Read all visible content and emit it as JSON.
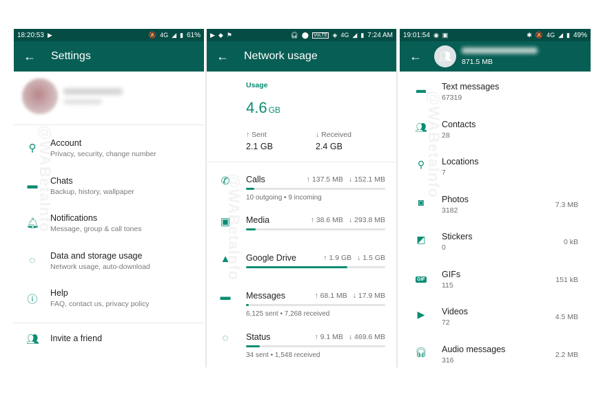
{
  "watermark": "@WABetaInfo",
  "colors": {
    "status_bar": "#054d44",
    "app_bar": "#075e54",
    "accent": "#0a8d73"
  },
  "settings_screen": {
    "status_time": "18:20:53",
    "status_network": "4G",
    "status_battery": "61%",
    "title": "Settings",
    "items": [
      {
        "icon": "key-icon",
        "title": "Account",
        "subtitle": "Privacy, security, change number"
      },
      {
        "icon": "chat-icon",
        "title": "Chats",
        "subtitle": "Backup, history, wallpaper"
      },
      {
        "icon": "bell-icon",
        "title": "Notifications",
        "subtitle": "Message, group & call tones"
      },
      {
        "icon": "data-usage-icon",
        "title": "Data and storage usage",
        "subtitle": "Network usage, auto-download"
      },
      {
        "icon": "help-icon",
        "title": "Help",
        "subtitle": "FAQ, contact us, privacy policy"
      }
    ],
    "invite": {
      "icon": "people-icon",
      "title": "Invite a friend"
    }
  },
  "network_screen": {
    "status_time": "7:24 AM",
    "status_volte": "VoLTE",
    "status_network": "4G",
    "title": "Network usage",
    "usage_label": "Usage",
    "usage_total": "4.6",
    "usage_unit": "GB",
    "sent_label": "Sent",
    "sent_value": "2.1 GB",
    "received_label": "Received",
    "received_value": "2.4 GB",
    "items": [
      {
        "icon": "phone-icon",
        "title": "Calls",
        "sent": "137.5 MB",
        "received": "152.1 MB",
        "progress": 0.06,
        "subtitle": "10 outgoing • 9 incoming"
      },
      {
        "icon": "photo-library-icon",
        "title": "Media",
        "sent": "38.6 MB",
        "received": "293.8 MB",
        "progress": 0.07,
        "subtitle": ""
      },
      {
        "icon": "google-drive-icon",
        "title": "Google Drive",
        "sent": "1.9 GB",
        "received": "1.5 GB",
        "progress": 0.73,
        "subtitle": ""
      },
      {
        "icon": "message-icon",
        "title": "Messages",
        "sent": "68.1 MB",
        "received": "17.9 MB",
        "progress": 0.02,
        "subtitle": "6,125 sent • 7,268 received"
      },
      {
        "icon": "status-icon",
        "title": "Status",
        "sent": "9.1 MB",
        "received": "469.6 MB",
        "progress": 0.1,
        "subtitle": "34 sent • 1,548 received"
      }
    ]
  },
  "storage_screen": {
    "status_time": "19:01:54",
    "status_network": "4G",
    "status_battery": "49%",
    "group_size": "871.5 MB",
    "items": [
      {
        "icon": "message-icon",
        "title": "Text messages",
        "count": "67319",
        "size": ""
      },
      {
        "icon": "people-icon",
        "title": "Contacts",
        "count": "28",
        "size": ""
      },
      {
        "icon": "location-pin-icon",
        "title": "Locations",
        "count": "7",
        "size": ""
      },
      {
        "icon": "camera-icon",
        "title": "Photos",
        "count": "3182",
        "size": "7.3 MB"
      },
      {
        "icon": "sticker-icon",
        "title": "Stickers",
        "count": "0",
        "size": "0 kB"
      },
      {
        "icon": "gif-icon",
        "title": "GIFs",
        "count": "115",
        "size": "151 kB"
      },
      {
        "icon": "video-icon",
        "title": "Videos",
        "count": "72",
        "size": "4.5 MB"
      },
      {
        "icon": "headphones-icon",
        "title": "Audio messages",
        "count": "316",
        "size": "2.2 MB"
      }
    ]
  }
}
